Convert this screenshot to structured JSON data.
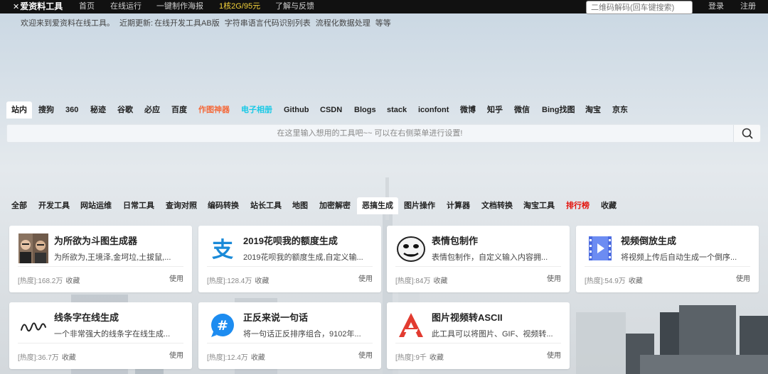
{
  "topnav": {
    "logo": "爱资料工具",
    "items": [
      "首页",
      "在线运行",
      "一键制作海报",
      "1核2G/95元",
      "了解与反馈"
    ],
    "qr_search_placeholder": "二维码解码(回车键搜索)",
    "login": "登录",
    "register": "注册"
  },
  "welcome": {
    "greeting": "欢迎来到爱资料在线工具。",
    "updates_label": "近期更新:",
    "updates": [
      "在线开发工具AB版",
      "字符串语言代码识别列表",
      "流程化数据处理",
      "等等"
    ]
  },
  "engines": [
    "站内",
    "搜狗",
    "360",
    "秘迹",
    "谷歌",
    "必应",
    "百度",
    "作图神器",
    "电子相册",
    "Github",
    "CSDN",
    "Blogs",
    "stack",
    "iconfont",
    "微博",
    "知乎",
    "微信",
    "Bing找图",
    "淘宝",
    "京东"
  ],
  "engine_colors": {
    "作图神器": "#f46a3b",
    "电子相册": "#18c9e6"
  },
  "search": {
    "placeholder": "在这里输入想用的工具吧~~ 可以在右侧菜单进行设置!"
  },
  "categories": [
    "全部",
    "开发工具",
    "网站运维",
    "日常工具",
    "查询对照",
    "编码转换",
    "站长工具",
    "地图",
    "加密解密",
    "恶搞生成",
    "图片操作",
    "计算器",
    "文档转换",
    "淘宝工具",
    "排行榜",
    "收藏"
  ],
  "active_category": "恶搞生成",
  "hot_category": "排行榜",
  "cards": [
    {
      "title": "为所欲为斗图生成器",
      "desc": "为所欲为,王境泽,金坷垃,土拔鼠,...",
      "meta": "[热度]:168.2万",
      "icon": "face-photo-icon"
    },
    {
      "title": "2019花呗我的额度生成",
      "desc": "2019花呗我的额度生成,自定义输...",
      "meta": "[热度]:128.4万",
      "icon": "alipay-icon"
    },
    {
      "title": "表情包制作",
      "desc": "表情包制作，自定义输入内容拥...",
      "meta": "[热度]:84万",
      "icon": "meme-face-icon"
    },
    {
      "title": "视频倒放生成",
      "desc": "将视频上传后自动生成一个倒序...",
      "meta": "[热度]:54.9万",
      "icon": "video-play-icon"
    },
    {
      "title": "线条字在线生成",
      "desc": "一个非常强大的线条字在线生成...",
      "meta": "[热度]:36.7万",
      "icon": "line-signature-icon"
    },
    {
      "title": "正反来说一句话",
      "desc": "将一句话正反排序组合，9102年...",
      "meta": "[热度]:12.4万",
      "icon": "hashtag-icon"
    },
    {
      "title": "图片视频转ASCII",
      "desc": "此工具可以将图片、GIF、视频转...",
      "meta": "[热度]:9千",
      "icon": "ascii-logo-icon"
    }
  ],
  "card_labels": {
    "fav": "收藏",
    "use": "使用"
  },
  "colors": {
    "nav_bg": "#111111",
    "promo": "#f5d33a",
    "hot": "#e3120b"
  }
}
